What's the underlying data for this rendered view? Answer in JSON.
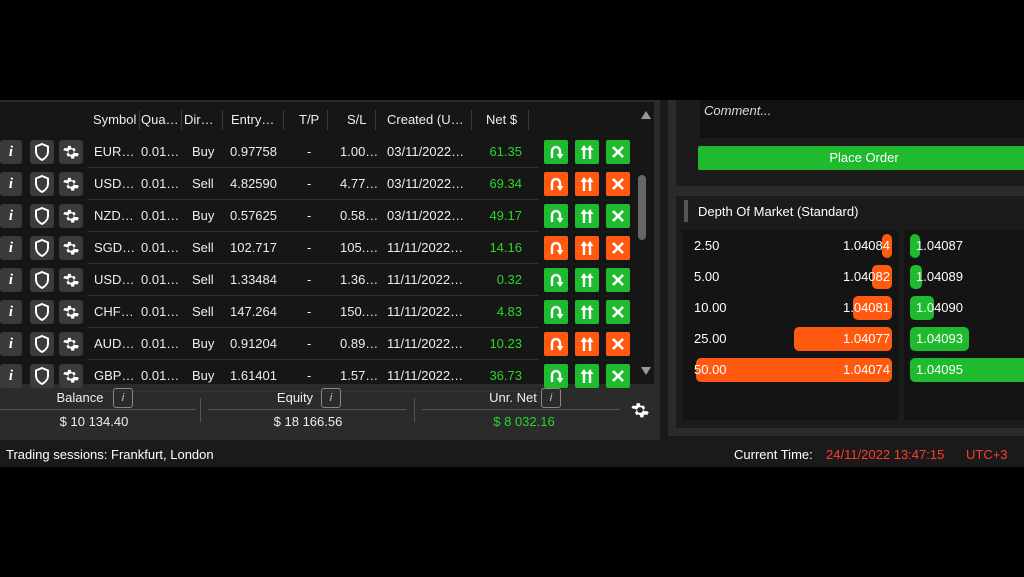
{
  "positions": {
    "columns": [
      "Symbol",
      "Qua…",
      "Dire…",
      "Entry…",
      "T/P",
      "S/L",
      "Created (U…",
      "Net $"
    ],
    "rows": [
      {
        "symbol": "EUR…",
        "qty": "0.01…",
        "dir": "Buy",
        "entry": "0.97758",
        "tp": "-",
        "sl": "1.00…",
        "created": "03/11/2022…",
        "net": "61.35",
        "tone": "g"
      },
      {
        "symbol": "USD…",
        "qty": "0.01…",
        "dir": "Sell",
        "entry": "4.82590",
        "tp": "-",
        "sl": "4.77…",
        "created": "03/11/2022…",
        "net": "69.34",
        "tone": "o"
      },
      {
        "symbol": "NZD…",
        "qty": "0.01…",
        "dir": "Buy",
        "entry": "0.57625",
        "tp": "-",
        "sl": "0.58…",
        "created": "03/11/2022…",
        "net": "49.17",
        "tone": "g"
      },
      {
        "symbol": "SGD…",
        "qty": "0.01…",
        "dir": "Sell",
        "entry": "102.717",
        "tp": "-",
        "sl": "105.…",
        "created": "11/11/2022…",
        "net": "14.16",
        "tone": "o"
      },
      {
        "symbol": "USD…",
        "qty": "0.01…",
        "dir": "Sell",
        "entry": "1.33484",
        "tp": "-",
        "sl": "1.36…",
        "created": "11/11/2022…",
        "net": "0.32",
        "tone": "g"
      },
      {
        "symbol": "CHF…",
        "qty": "0.01…",
        "dir": "Sell",
        "entry": "147.264",
        "tp": "-",
        "sl": "150.…",
        "created": "11/11/2022…",
        "net": "4.83",
        "tone": "g"
      },
      {
        "symbol": "AUD…",
        "qty": "0.01…",
        "dir": "Buy",
        "entry": "0.91204",
        "tp": "-",
        "sl": "0.89…",
        "created": "11/11/2022…",
        "net": "10.23",
        "tone": "o"
      },
      {
        "symbol": "GBP…",
        "qty": "0.01…",
        "dir": "Buy",
        "entry": "1.61401",
        "tp": "-",
        "sl": "1.57…",
        "created": "11/11/2022…",
        "net": "36.73",
        "tone": "g"
      }
    ]
  },
  "totals": {
    "balance_label": "Balance",
    "balance": "$ 10 134.40",
    "equity_label": "Equity",
    "equity": "$ 18 166.56",
    "unr_label": "Unr. Net",
    "unr": "$ 8 032.16"
  },
  "order": {
    "comment_placeholder": "Comment...",
    "place_order": "Place Order"
  },
  "dom": {
    "title": "Depth Of Market (Standard)",
    "bids": [
      {
        "vol": "2.50",
        "price": "1.04084",
        "fill": 0.05
      },
      {
        "vol": "5.00",
        "price": "1.04082",
        "fill": 0.1
      },
      {
        "vol": "10.00",
        "price": "1.04081",
        "fill": 0.2
      },
      {
        "vol": "25.00",
        "price": "1.04077",
        "fill": 0.5
      },
      {
        "vol": "50.00",
        "price": "1.04074",
        "fill": 1.0
      }
    ],
    "asks": [
      {
        "price": "1.04087",
        "fill": 0.05
      },
      {
        "price": "1.04089",
        "fill": 0.1
      },
      {
        "price": "1.04090",
        "fill": 0.2
      },
      {
        "price": "1.04093",
        "fill": 0.5
      },
      {
        "price": "1.04095",
        "fill": 1.0
      }
    ]
  },
  "status": {
    "sessions": "Trading sessions: Frankfurt, London",
    "time_label": "Current Time:",
    "time": "24/11/2022 13:47:15",
    "tz": "UTC+3"
  },
  "colors": {
    "green": "#1fba2e",
    "orange": "#ff5a10",
    "net_green": "#2bd62b",
    "time_red": "#ff3b30"
  }
}
